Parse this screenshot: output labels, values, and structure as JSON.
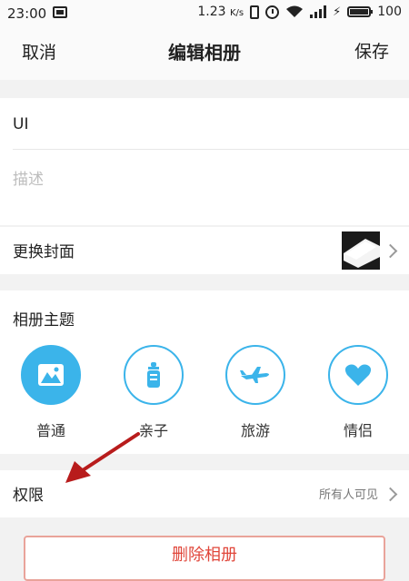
{
  "status_bar": {
    "time": "23:00",
    "speed": "1.23",
    "speed_unit": "K/s",
    "battery": "100"
  },
  "navbar": {
    "cancel": "取消",
    "title": "编辑相册",
    "save": "保存"
  },
  "album": {
    "name": "UI",
    "description_placeholder": "描述"
  },
  "cover": {
    "label": "更换封面"
  },
  "theme": {
    "label": "相册主题",
    "accent": "#3bb4ea",
    "options": [
      {
        "name": "普通",
        "icon": "mountain-icon",
        "selected": true
      },
      {
        "name": "亲子",
        "icon": "baby-bottle-icon",
        "selected": false
      },
      {
        "name": "旅游",
        "icon": "airplane-icon",
        "selected": false
      },
      {
        "name": "情侣",
        "icon": "heart-icon",
        "selected": false
      }
    ]
  },
  "permission": {
    "label": "权限",
    "value": "所有人可见"
  },
  "delete_button": {
    "label": "删除相册",
    "color": "#e0463a"
  },
  "annotation_arrow_color": "#b81c1c"
}
